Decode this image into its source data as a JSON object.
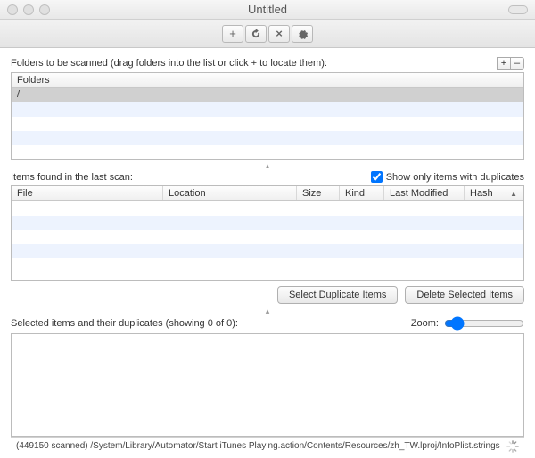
{
  "window": {
    "title": "Untitled"
  },
  "toolbar": {
    "add_tip": "Add",
    "refresh_tip": "Refresh",
    "cancel_tip": "Cancel",
    "settings_tip": "Settings"
  },
  "folders_section": {
    "label": "Folders to be scanned (drag folders into the list or click + to locate them):",
    "add_label": "+",
    "remove_label": "–",
    "header": "Folders",
    "rows": [
      "/"
    ]
  },
  "items_section": {
    "label": "Items found in the last scan:",
    "show_dupes_label": "Show only items with duplicates",
    "show_dupes_checked": true,
    "columns": {
      "file": "File",
      "location": "Location",
      "size": "Size",
      "kind": "Kind",
      "last_modified": "Last Modified",
      "hash": "Hash"
    }
  },
  "buttons": {
    "select_dupes": "Select Duplicate Items",
    "delete_selected": "Delete Selected Items"
  },
  "selected_section": {
    "label": "Selected items and their duplicates (showing 0 of 0):",
    "zoom_label": "Zoom:"
  },
  "status": {
    "text": "(449150 scanned) /System/Library/Automator/Start iTunes Playing.action/Contents/Resources/zh_TW.lproj/InfoPlist.strings"
  }
}
